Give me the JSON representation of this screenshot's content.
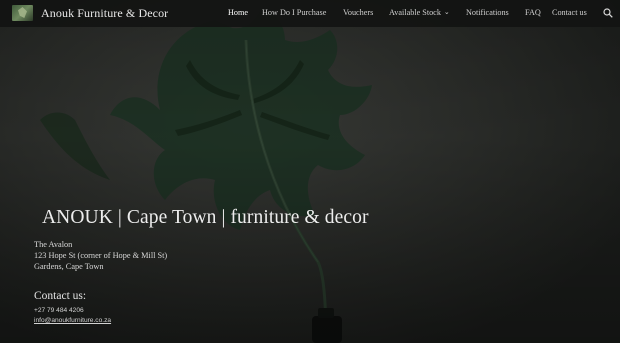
{
  "site": {
    "title": "Anouk Furniture & Decor"
  },
  "nav": {
    "items": [
      {
        "label": "Home"
      },
      {
        "label": "How Do I Purchase"
      },
      {
        "label": "Vouchers"
      },
      {
        "label": "Available Stock"
      },
      {
        "label": "Notifications"
      },
      {
        "label": "FAQ"
      },
      {
        "label": "Contact us"
      }
    ],
    "active": "Home"
  },
  "hero": {
    "headline": "ANOUK | Cape Town | furniture & decor",
    "address": [
      "The Avalon",
      "123 Hope St (corner of Hope & Mill St)",
      "Gardens, Cape Town"
    ],
    "contact_heading": "Contact us:",
    "phone": "+27 79 484 4206",
    "email": "info@anoukfurniture.co.za"
  },
  "icons": {
    "search": "search-icon",
    "dropdown": "chevron-down-icon",
    "logo": "logo-image"
  },
  "colors": {
    "nav_bg": "#121412",
    "text": "#e6e6e6",
    "leaf": "#24382a"
  }
}
